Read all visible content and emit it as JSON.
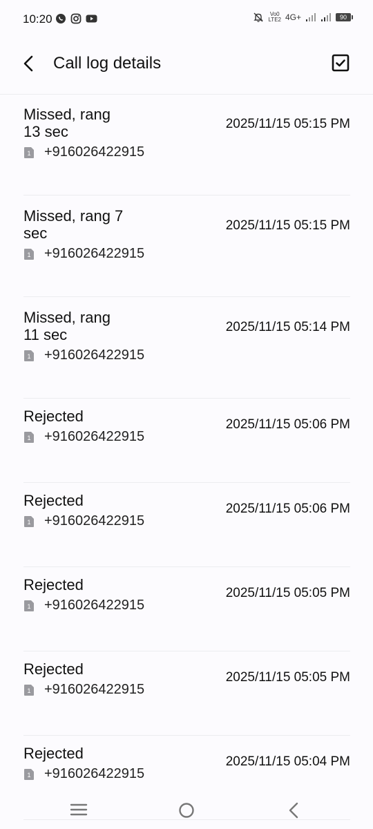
{
  "status_bar": {
    "time": "10:20",
    "network_type": "4G+",
    "volte_line1": "Vo0",
    "volte_line2": "LTE2",
    "battery": "90"
  },
  "app_bar": {
    "title": "Call log details"
  },
  "calls": [
    {
      "status": "Missed, rang 13 sec",
      "number": "+916026422915",
      "time": "2025/11/15 05:15 PM"
    },
    {
      "status": "Missed, rang 7 sec",
      "number": "+916026422915",
      "time": "2025/11/15 05:15 PM"
    },
    {
      "status": "Missed, rang 11 sec",
      "number": "+916026422915",
      "time": "2025/11/15 05:14 PM"
    },
    {
      "status": "Rejected",
      "number": "+916026422915",
      "time": "2025/11/15 05:06 PM"
    },
    {
      "status": "Rejected",
      "number": "+916026422915",
      "time": "2025/11/15 05:06 PM"
    },
    {
      "status": "Rejected",
      "number": "+916026422915",
      "time": "2025/11/15 05:05 PM"
    },
    {
      "status": "Rejected",
      "number": "+916026422915",
      "time": "2025/11/15 05:05 PM"
    },
    {
      "status": "Rejected",
      "number": "+916026422915",
      "time": "2025/11/15 05:04 PM"
    }
  ],
  "sim_label": "1",
  "icons": {
    "back": "back-arrow-icon",
    "select": "checkbox-icon",
    "sim": "sim-card-icon",
    "nav_menu": "menu-icon",
    "nav_home": "home-icon",
    "nav_back": "nav-back-icon"
  }
}
